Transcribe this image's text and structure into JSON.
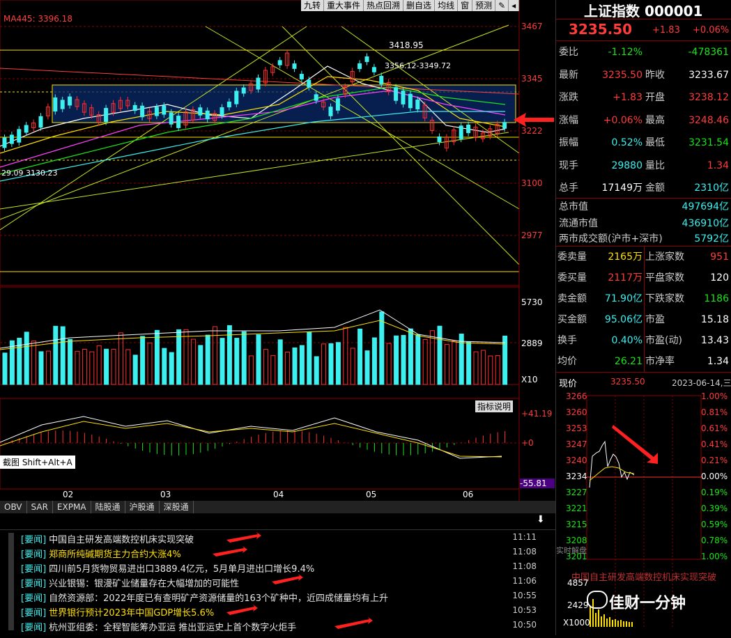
{
  "chart": {
    "ma_label": "MA445: 3396.18",
    "price_ticks": [
      "3467",
      "3345",
      "3222",
      "3100",
      "2977"
    ],
    "annotations": {
      "high": "3418.95",
      "range": "3356.12-3349.72",
      "low": "29.09 3130.23"
    },
    "volume_ticks": [
      "5730",
      "2889",
      "X10"
    ],
    "macd_ticks": [
      "+41.19",
      "+0",
      "-55.81"
    ],
    "months": [
      "02",
      "03",
      "04",
      "05",
      "06"
    ],
    "indicator_help": "指标说明",
    "screenshot_hint": "截图 Shift+Alt+A"
  },
  "toolbar": [
    "九转",
    "重大事件",
    "热点回溯",
    "删自选",
    "均线",
    "窗",
    "预测"
  ],
  "indicator_tabs": [
    "OBV",
    "SAR",
    "EXPMA",
    "陆股通",
    "沪股通",
    "深股通"
  ],
  "news": [
    {
      "tag": "[要闻]",
      "title": "中国自主研发高端数控机床实现突破",
      "time": "11:11"
    },
    {
      "tag": "[要闻]",
      "title": "郑商所纯碱期货主力合约大涨4%",
      "time": "11:08"
    },
    {
      "tag": "[要闻]",
      "title": "四川前5月货物贸易进出口3889.4亿元，5月单月进出口增长9.4%",
      "time": "11:08"
    },
    {
      "tag": "[要闻]",
      "title": "兴业银锡：银漫矿业储量存在大幅增加的可能性",
      "time": "11:06"
    },
    {
      "tag": "[要闻]",
      "title": "自然资源部：2022年度已有查明矿产资源储量的163个矿种中，近四成储量均有上升",
      "time": "10:55"
    },
    {
      "tag": "[要闻]",
      "title": "世界银行预计2023年中国GDP增长5.6%",
      "time": "10:53"
    },
    {
      "tag": "[要闻]",
      "title": "杭州亚组委：全程智能筹办亚运 推出亚运史上首个数字火炬手",
      "time": "10:50"
    }
  ],
  "quote": {
    "title": "上证指数 000001",
    "price": "3235.50",
    "change": "+1.83",
    "change_pct": "+0.06%",
    "rows": [
      {
        "l1": "委比",
        "v1": "-1.12%",
        "c1": "green",
        "l2": "",
        "v2": "-478361",
        "c2": "green"
      },
      {
        "l1": "最新",
        "v1": "3235.50",
        "c1": "red",
        "l2": "昨收",
        "v2": "3233.67",
        "c2": "white"
      },
      {
        "l1": "涨跌",
        "v1": "+1.83",
        "c1": "red",
        "l2": "开盘",
        "v2": "3238.12",
        "c2": "red"
      },
      {
        "l1": "涨幅",
        "v1": "+0.06%",
        "c1": "red",
        "l2": "最高",
        "v2": "3248.46",
        "c2": "red"
      },
      {
        "l1": "振幅",
        "v1": "0.52%",
        "c1": "cyan",
        "l2": "最低",
        "v2": "3231.54",
        "c2": "green"
      },
      {
        "l1": "现手",
        "v1": "29880",
        "c1": "cyan",
        "l2": "量比",
        "v2": "1.34",
        "c2": "red"
      },
      {
        "l1": "总手",
        "v1": "17149万",
        "c1": "white",
        "l2": "金额",
        "v2": "2310亿",
        "c2": "cyan"
      }
    ],
    "market": [
      {
        "l": "总市值",
        "v": "497694亿"
      },
      {
        "l": "流通市值",
        "v": "436910亿"
      },
      {
        "l": "两市成交额(沪市+深市)",
        "v": "5792亿"
      }
    ],
    "stats": [
      {
        "l1": "委卖量",
        "v1": "2165万",
        "c1": "yellow",
        "l2": "上涨家数",
        "v2": "951",
        "c2": "red"
      },
      {
        "l1": "委买量",
        "v1": "2117万",
        "c1": "red",
        "l2": "平盘家数",
        "v2": "120",
        "c2": "white"
      },
      {
        "l1": "卖金额",
        "v1": "71.90亿",
        "c1": "cyan",
        "l2": "下跌家数",
        "v2": "1186",
        "c2": "green"
      },
      {
        "l1": "买金额",
        "v1": "95.06亿",
        "c1": "cyan",
        "l2": "市盈",
        "v2": "15.18",
        "c2": "white"
      },
      {
        "l1": "换手",
        "v1": "0.40%",
        "c1": "cyan",
        "l2": "市盈(动)",
        "v2": "13.43",
        "c2": "white"
      },
      {
        "l1": "均价",
        "v1": "26.21",
        "c1": "green",
        "l2": "市净率",
        "v2": "1.34",
        "c2": "white"
      }
    ],
    "mini": {
      "label": "现价",
      "price": "3235.50",
      "date": "2023-06-14,三",
      "left_ticks": [
        "3266",
        "3260",
        "3253",
        "3247",
        "3240",
        "3234",
        "3227",
        "3221",
        "3215",
        "3208",
        "3201"
      ],
      "right_ticks": [
        "1.00%",
        "0.81%",
        "0.61%",
        "0.41%",
        "0.21%",
        "0.00%",
        "0.19%",
        "0.39%",
        "0.59%",
        "0.78%",
        "1.00%"
      ],
      "vol_ticks": [
        "4857",
        "2429",
        "X1000"
      ],
      "overlay_title": "中国自主研发高端数控机床实现突破",
      "realtime": "实时解盘"
    },
    "watermark": "佳财一分钟"
  }
}
